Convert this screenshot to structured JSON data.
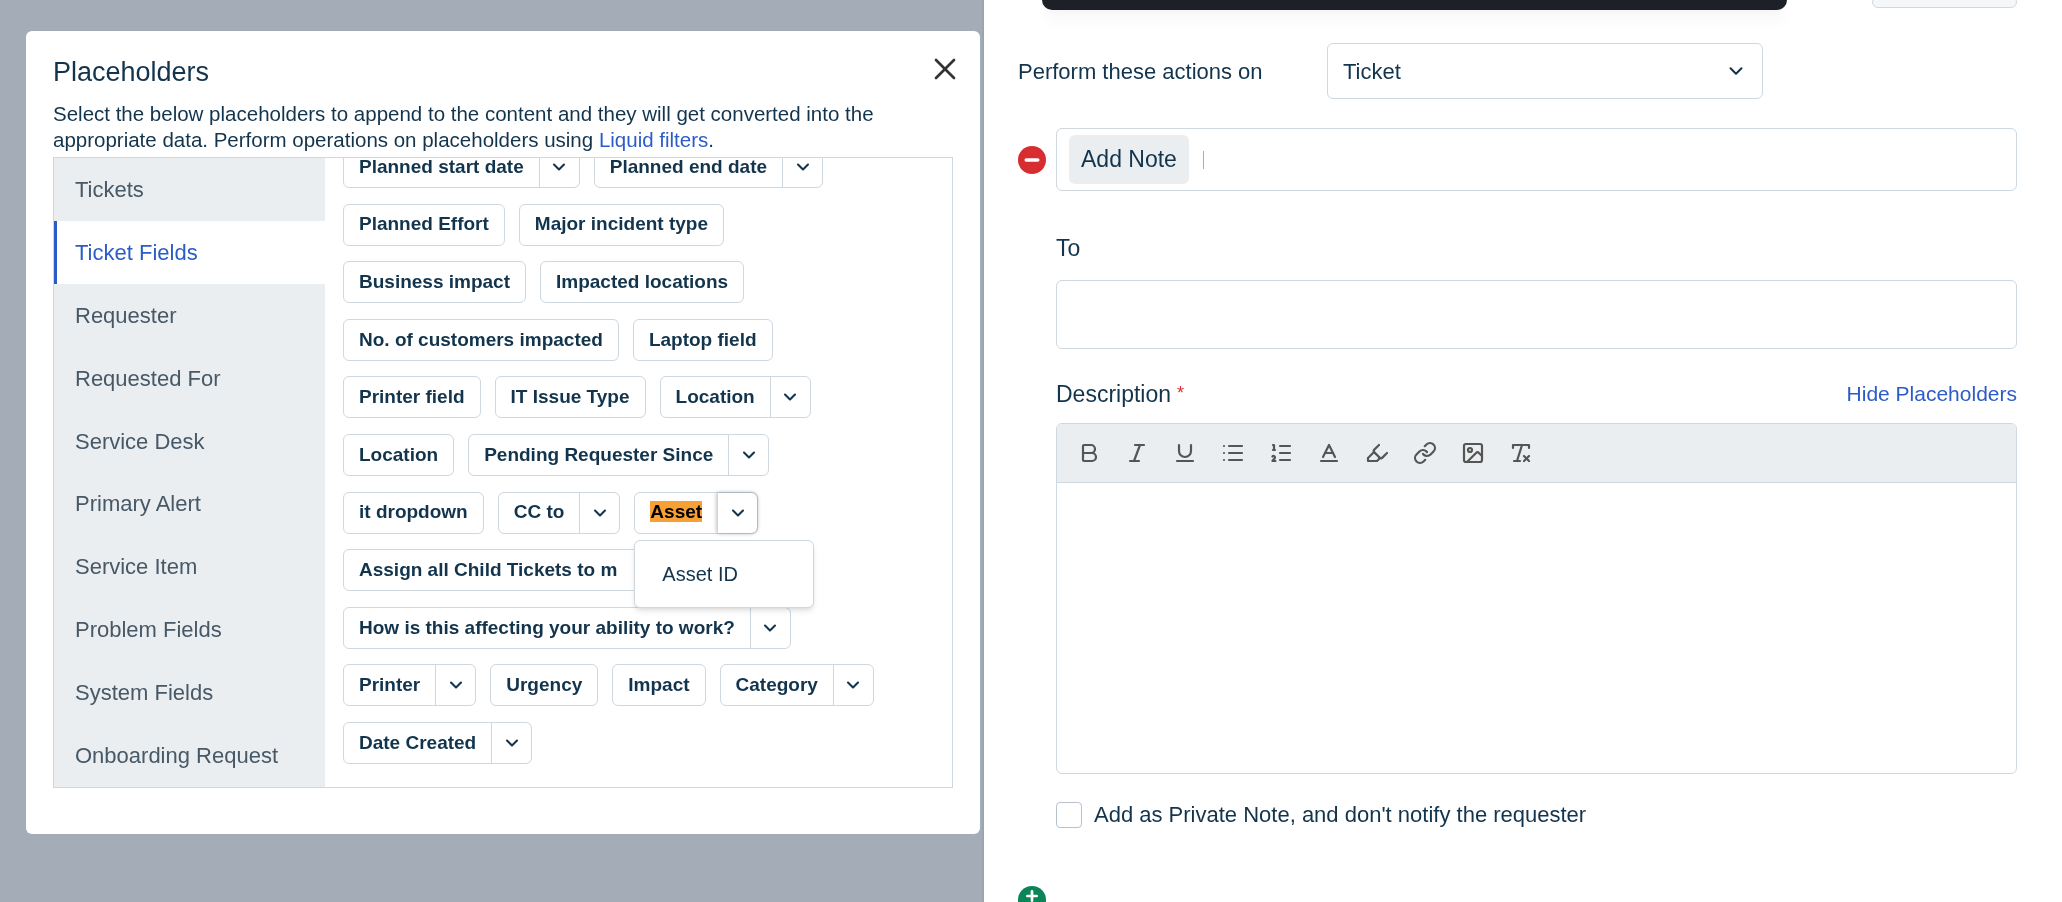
{
  "modal": {
    "title": "Placeholders",
    "description": "Select the below placeholders to append to the content and they will get converted into the appropriate data. Perform operations on placeholders using ",
    "link": "Liquid filters",
    "description_end": ".",
    "categories": [
      {
        "label": "Tickets",
        "selected": false
      },
      {
        "label": "Ticket Fields",
        "selected": true
      },
      {
        "label": "Requester",
        "selected": false
      },
      {
        "label": "Requested For",
        "selected": false
      },
      {
        "label": "Service Desk",
        "selected": false
      },
      {
        "label": "Primary Alert",
        "selected": false
      },
      {
        "label": "Service Item",
        "selected": false
      },
      {
        "label": "Problem Fields",
        "selected": false
      },
      {
        "label": "System Fields",
        "selected": false
      },
      {
        "label": "Onboarding Request",
        "selected": false
      }
    ],
    "placeholder_rows": [
      [
        {
          "label": "Planned start date",
          "has_menu": true
        },
        {
          "label": "Planned end date",
          "has_menu": true
        }
      ],
      [
        {
          "label": "Planned Effort",
          "has_menu": false
        },
        {
          "label": "Major incident type",
          "has_menu": false
        }
      ],
      [
        {
          "label": "Business impact",
          "has_menu": false
        },
        {
          "label": "Impacted locations",
          "has_menu": false
        }
      ],
      [
        {
          "label": "No. of customers impacted",
          "has_menu": false
        },
        {
          "label": "Laptop field",
          "has_menu": false
        }
      ],
      [
        {
          "label": "Printer field",
          "has_menu": false
        },
        {
          "label": "IT Issue Type",
          "has_menu": false
        },
        {
          "label": "Location",
          "has_menu": true
        }
      ],
      [
        {
          "label": "Location",
          "has_menu": false
        },
        {
          "label": "Pending Requester Since",
          "has_menu": true
        }
      ],
      [
        {
          "label": "it dropdown",
          "has_menu": false
        },
        {
          "label": "CC to",
          "has_menu": true
        },
        {
          "label": "Asset",
          "has_menu": true,
          "highlighted": true,
          "menu_open": true,
          "menu_items": [
            "Asset ID"
          ]
        }
      ],
      [
        {
          "label": "Assign all Child Tickets to m",
          "has_menu": false,
          "covered": true
        }
      ],
      [
        {
          "label": "How is this affecting your ability to work?",
          "has_menu": true
        }
      ],
      [
        {
          "label": "Printer",
          "has_menu": true
        },
        {
          "label": "Urgency",
          "has_menu": false
        },
        {
          "label": "Impact",
          "has_menu": false
        },
        {
          "label": "Category",
          "has_menu": true
        }
      ],
      [
        {
          "label": "Date Created",
          "has_menu": true
        }
      ]
    ]
  },
  "form": {
    "target_label": "Perform these actions on",
    "target_value": "Ticket",
    "action": "Add Note",
    "to_label": "To",
    "description_label": "Description",
    "required_mark": "*",
    "hide_link": "Hide Placeholders",
    "private_note": {
      "label": "Add as Private Note, and don't notify the requester",
      "checked": false
    }
  }
}
